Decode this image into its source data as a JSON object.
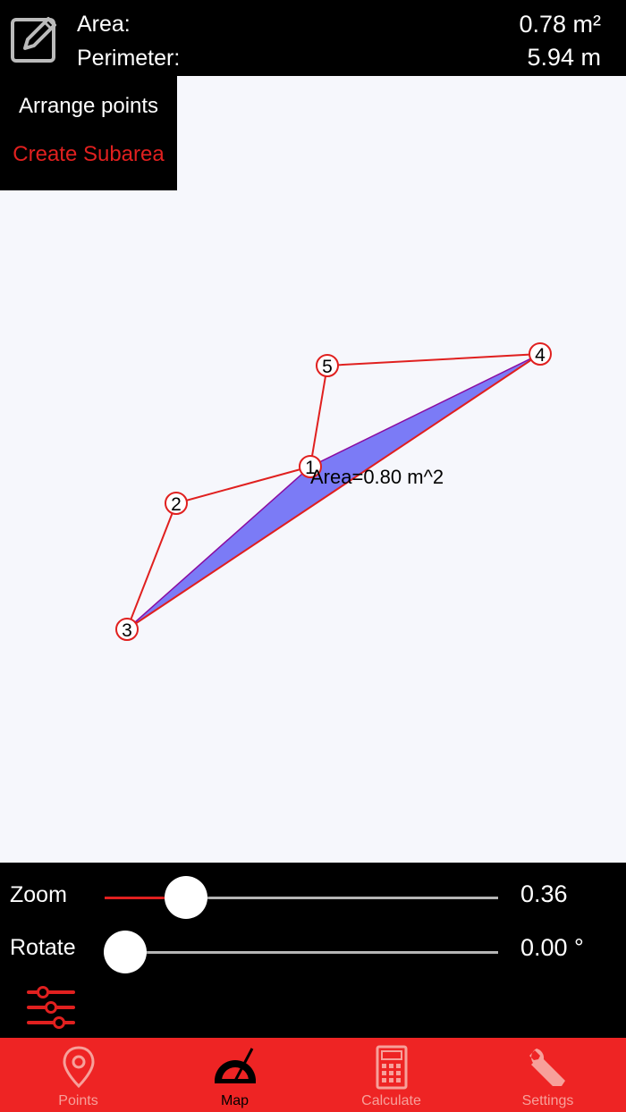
{
  "header": {
    "edit_icon": "edit-icon",
    "area_label": "Area:",
    "area_value": "0.78 m²",
    "perimeter_label": "Perimeter:",
    "perimeter_value": "5.94 m"
  },
  "menu": {
    "arrange_points": "Arrange points",
    "create_subarea": "Create Subarea",
    "create_subarea_color": "#e0201f"
  },
  "map": {
    "points": [
      {
        "label": "1"
      },
      {
        "label": "2"
      },
      {
        "label": "3"
      },
      {
        "label": "4"
      },
      {
        "label": "5"
      }
    ],
    "subarea_label": "Area=0.80 m^2",
    "outline_color": "#e0201f",
    "subarea_fill": "#7b7bf6"
  },
  "controls": {
    "zoom_label": "Zoom",
    "zoom_value": "0.36",
    "zoom_level": 0.17,
    "rotate_label": "Rotate",
    "rotate_value": "0.00 °",
    "rotate_level": 0.0,
    "filter_icon": "sliders-icon"
  },
  "tabs": [
    {
      "label": "Points",
      "icon": "map-pin-icon",
      "active": false
    },
    {
      "label": "Map",
      "icon": "protractor-icon",
      "active": true
    },
    {
      "label": "Calculate",
      "icon": "calculator-icon",
      "active": false
    },
    {
      "label": "Settings",
      "icon": "wrench-icon",
      "active": false
    }
  ],
  "colors": {
    "accent": "#ee2424",
    "header_bg": "#000000",
    "map_bg": "#f6f7fc"
  }
}
